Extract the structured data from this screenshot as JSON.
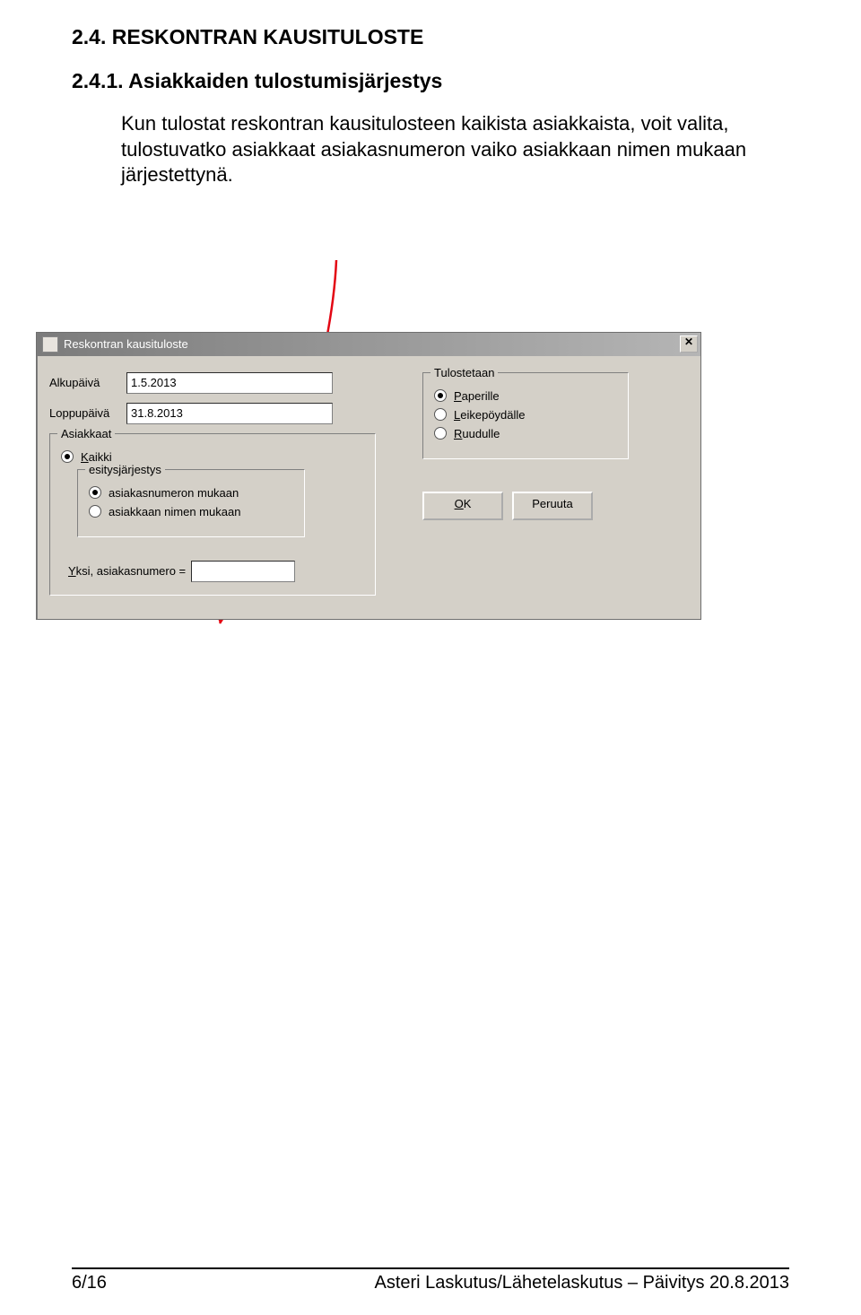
{
  "section_title": "2.4. RESKONTRAN KAUSITULOSTE",
  "subsection_title": "2.4.1. Asiakkaiden tulostumisjärjestys",
  "paragraph": "Kun tulostat reskontran kausitulosteen kaikista asiakkaista, voit valita, tulostuvatko asiakkaat asiakasnumeron vaiko asiakkaan nimen mukaan järjestettynä.",
  "dialog": {
    "title": "Reskontran kausituloste",
    "alkupaiva_label": "Alkupäivä",
    "alkupaiva_value": "1.5.2013",
    "loppupaiva_label": "Loppupäivä",
    "loppupaiva_value": "31.8.2013",
    "asiakkaat": {
      "legend": "Asiakkaat",
      "kaikki": "Kaikki",
      "esitys": {
        "legend": "esitysjärjestys",
        "opt1": "asiakasnumeron mukaan",
        "opt2": "asiakkaan nimen mukaan"
      },
      "yksi_label": "Yksi, asiakasnumero ="
    },
    "tulostetaan": {
      "legend": "Tulostetaan",
      "opt1": "Paperille",
      "opt2": "Leikepöydälle",
      "opt3": "Ruudulle"
    },
    "ok": "OK",
    "cancel": "Peruuta"
  },
  "footer_left": "6/16",
  "footer_right": "Asteri Laskutus/Lähetelaskutus – Päivitys 20.8.2013"
}
